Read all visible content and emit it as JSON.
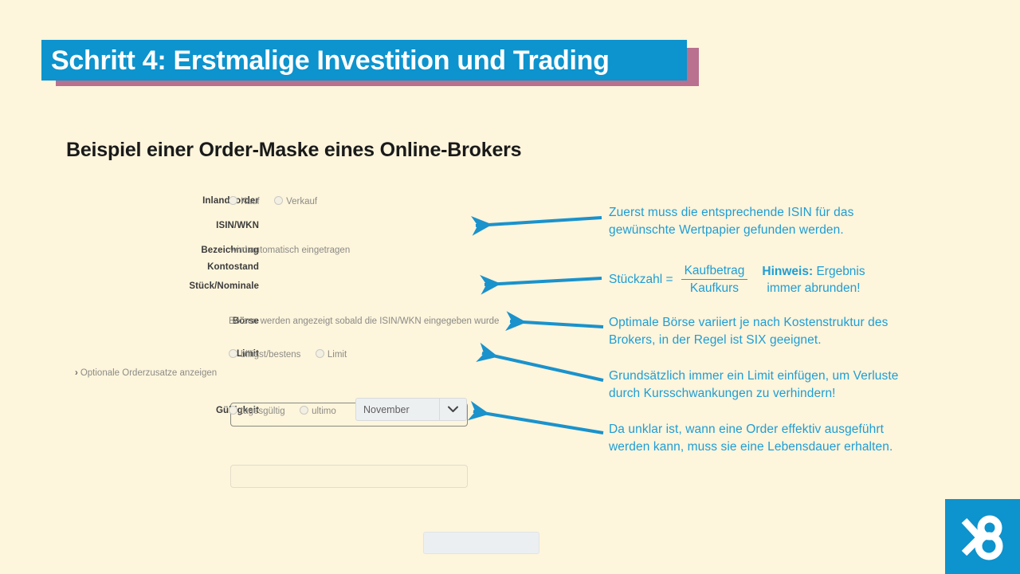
{
  "slide": {
    "title": "Schritt 4: Erstmalige Investition und Trading",
    "subtitle": "Beispiel einer Order-Maske eines Online-Brokers",
    "background_color": "#fdf5dc",
    "accent_color": "#0d93cd",
    "shadow_color": "#b9718f",
    "annotation_color": "#1f9dd4"
  },
  "form": {
    "rows": {
      "inlandsorder": {
        "label": "Inlandsorder",
        "options": [
          "Kauf",
          "Verkauf"
        ]
      },
      "isin_wkn": {
        "label": "ISIN/WKN",
        "value": "",
        "placeholder": ""
      },
      "bezeichnung": {
        "label": "Bezeichnung",
        "value": "wird automatisch eingetragen"
      },
      "kontostand": {
        "label": "Kontostand",
        "value": ""
      },
      "stueck_nominale": {
        "label": "Stück/Nominale",
        "value": "",
        "placeholder": ""
      },
      "boerse": {
        "label": "Börse",
        "value": "Börsen werden angezeigt sobald die ISIN/WKN eingegeben wurde"
      },
      "limit": {
        "label": "Limit",
        "options": [
          "billigst/bestens",
          "Limit"
        ],
        "value": "",
        "placeholder": ""
      },
      "optional": {
        "link": "Optionale Orderzusatze anzeigen",
        "chevron": "›"
      },
      "gueltigkeit": {
        "label": "Gültigkeit",
        "options": [
          "tagesgültig",
          "ultimo"
        ],
        "select_value": "November"
      }
    }
  },
  "annotations": {
    "isin": "Zuerst muss die entsprechende ISIN für das\ngewünschte Wertpapier gefunden werden.",
    "formula": {
      "lhs": "Stückzahl =",
      "numerator": "Kaufbetrag",
      "denominator": "Kaufkurs",
      "hint_strong": "Hinweis:",
      "hint_rest": " Ergebnis",
      "hint_line2": "immer abrunden!"
    },
    "boerse": "Optimale Börse variiert je nach Kostenstruktur des\nBrokers, in der Regel ist SIX geeignet.",
    "limit": "Grundsätzlich immer ein Limit einfügen, um Verluste\ndurch Kursschwankungen zu verhindern!",
    "gueltigkeit": "Da unklar ist, wann eine Order effektiv ausgeführt\nwerden kann, muss sie eine Lebensdauer erhalten."
  }
}
